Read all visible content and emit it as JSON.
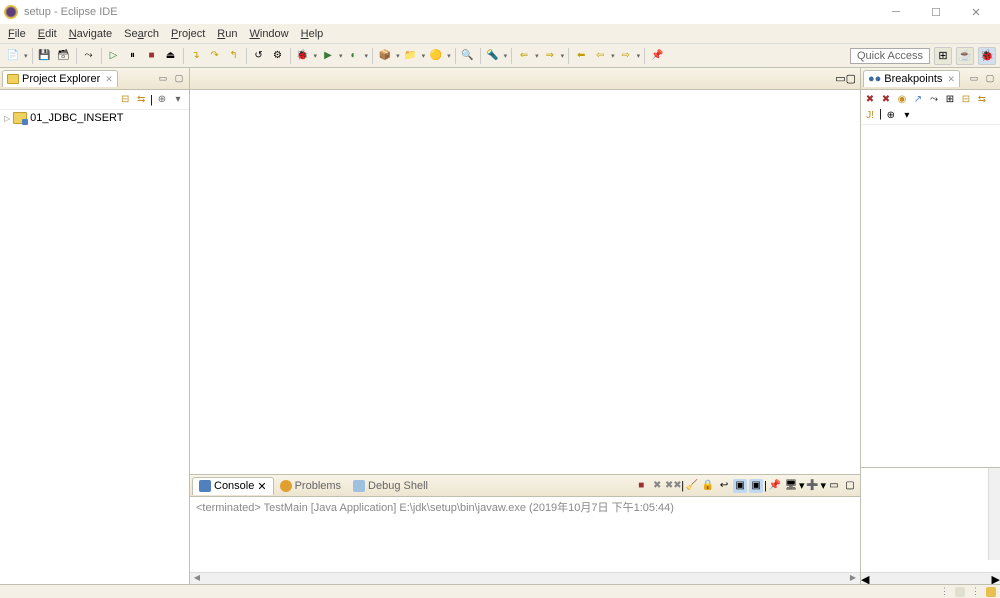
{
  "titlebar": {
    "title": "setup - Eclipse IDE"
  },
  "menubar": {
    "items": [
      {
        "label": "File",
        "m": "F"
      },
      {
        "label": "Edit",
        "m": "E"
      },
      {
        "label": "Navigate",
        "m": "N"
      },
      {
        "label": "Search",
        "m": "S"
      },
      {
        "label": "Project",
        "m": "P"
      },
      {
        "label": "Run",
        "m": "R"
      },
      {
        "label": "Window",
        "m": "W"
      },
      {
        "label": "Help",
        "m": "H"
      }
    ]
  },
  "toolbar": {
    "quick_access": "Quick Access"
  },
  "project_explorer": {
    "title": "Project Explorer",
    "items": [
      {
        "label": "01_JDBC_INSERT"
      }
    ]
  },
  "breakpoints": {
    "title": "Breakpoints"
  },
  "console": {
    "tabs": [
      {
        "label": "Console",
        "active": true
      },
      {
        "label": "Problems",
        "active": false
      },
      {
        "label": "Debug Shell",
        "active": false
      }
    ],
    "status_line": "<terminated> TestMain [Java Application] E:\\jdk\\setup\\bin\\javaw.exe (2019年10月7日 下午1:05:44)"
  }
}
